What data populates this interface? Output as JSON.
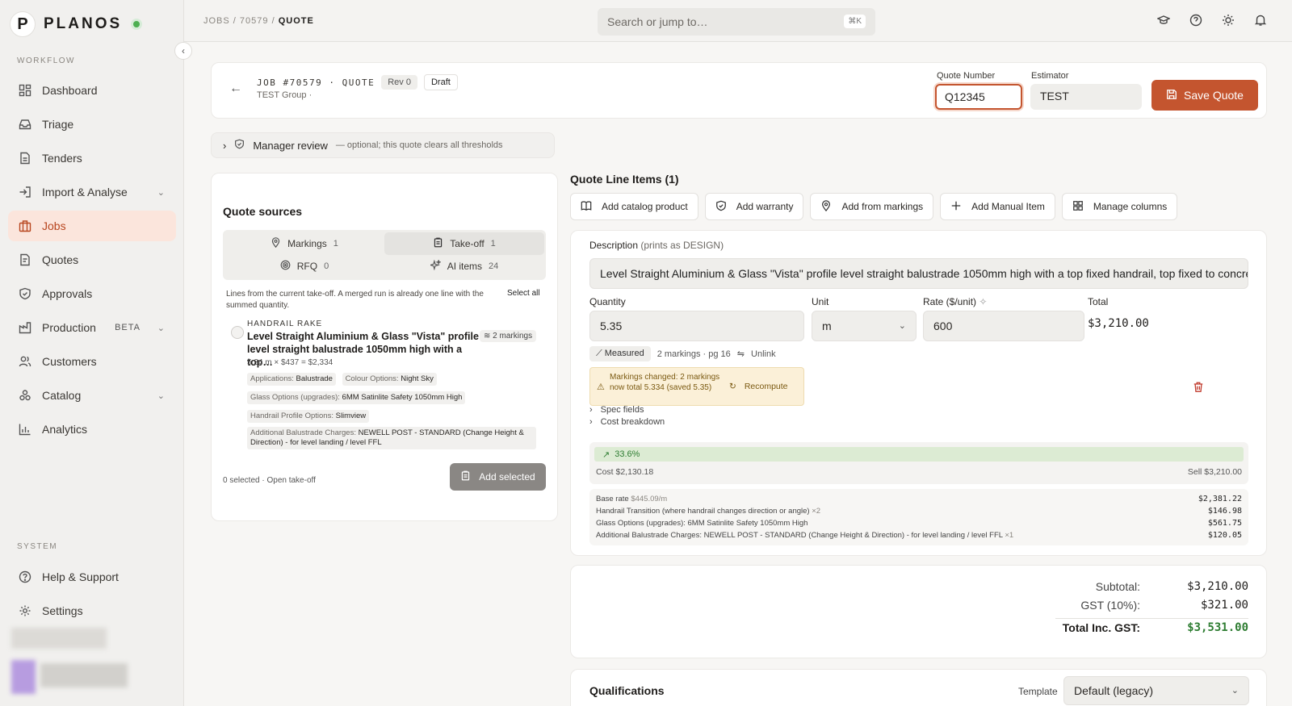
{
  "brand": {
    "name": "PLANOS"
  },
  "sidebar": {
    "workflow_label": "WORKFLOW",
    "system_label": "SYSTEM",
    "items": [
      {
        "label": "Dashboard",
        "icon": "dashboard-icon"
      },
      {
        "label": "Triage",
        "icon": "inbox-icon"
      },
      {
        "label": "Tenders",
        "icon": "document-icon"
      },
      {
        "label": "Import & Analyse",
        "icon": "import-icon"
      },
      {
        "label": "Jobs",
        "icon": "briefcase-icon"
      },
      {
        "label": "Quotes",
        "icon": "quote-icon"
      },
      {
        "label": "Approvals",
        "icon": "shield-check-icon"
      },
      {
        "label": "Production",
        "icon": "factory-icon",
        "badge": "BETA"
      },
      {
        "label": "Customers",
        "icon": "users-icon"
      },
      {
        "label": "Catalog",
        "icon": "catalog-icon"
      },
      {
        "label": "Analytics",
        "icon": "bar-chart-icon"
      }
    ],
    "system_items": [
      {
        "label": "Help & Support",
        "icon": "help-circle-icon"
      },
      {
        "label": "Settings",
        "icon": "gear-icon"
      }
    ]
  },
  "breadcrumb": {
    "part1": "JOBS",
    "sep": "/",
    "part2": "70579",
    "current": "QUOTE"
  },
  "search": {
    "placeholder": "Search or jump to…",
    "shortcut": "⌘K"
  },
  "header": {
    "job_label": "JOB #70579 · QUOTE",
    "rev": "Rev 0",
    "status": "Draft",
    "group": "TEST Group ·",
    "quote_number_label": "Quote Number",
    "quote_number": "Q12345",
    "estimator_label": "Estimator",
    "estimator": "TEST",
    "save_label": "Save Quote"
  },
  "manager_review": {
    "label": "Manager review",
    "note": "— optional; this quote clears all thresholds"
  },
  "sources": {
    "title": "Quote sources",
    "tabs": [
      {
        "label": "Markings",
        "count": "1"
      },
      {
        "label": "Take-off",
        "count": "1"
      },
      {
        "label": "RFQ",
        "count": "0"
      },
      {
        "label": "AI items",
        "count": "24"
      }
    ],
    "note": "Lines from the current take-off. A merged run is already one line with the summed quantity.",
    "select_all": "Select all",
    "item": {
      "kind": "HANDRAIL RAKE",
      "title": "Level Straight Aluminium & Glass \"Vista\" profile level straight balustrade 1050mm high with a top…",
      "markings": "2 markings",
      "calc": "5.34 m × $437 = $2,334",
      "tags": [
        {
          "k": "Applications:",
          "v": "Balustrade"
        },
        {
          "k": "Colour Options:",
          "v": "Night Sky"
        },
        {
          "k": "Glass Options (upgrades):",
          "v": "6MM Satinlite Safety 1050mm High"
        },
        {
          "k": "Handrail Profile Options:",
          "v": "Slimview"
        },
        {
          "k": "Additional Balustrade Charges:",
          "v": "NEWELL POST - STANDARD (Change Height & Direction) - for level landing / level FFL"
        }
      ]
    },
    "selected_text": "0 selected · Open take-off",
    "add_selected": "Add selected"
  },
  "line_items": {
    "title": "Quote Line Items (1)",
    "toolbar": [
      {
        "label": "Add catalog product",
        "icon": "book-icon"
      },
      {
        "label": "Add warranty",
        "icon": "shield-icon"
      },
      {
        "label": "Add from markings",
        "icon": "map-pin-icon"
      },
      {
        "label": "Add Manual Item",
        "icon": "plus-icon"
      },
      {
        "label": "Manage columns",
        "icon": "grid-icon"
      }
    ],
    "description_label": "Description",
    "description_hint": "(prints as DESIGN)",
    "description": "Level Straight Aluminium & Glass \"Vista\" profile level straight balustrade 1050mm high with a top fixed handrail, top fixed to concrete s",
    "quantity_label": "Quantity",
    "quantity": "5.35",
    "unit_label": "Unit",
    "unit": "m",
    "rate_label": "Rate ($/unit)",
    "rate": "600",
    "total_label": "Total",
    "total": "$3,210.00",
    "measured": "Measured",
    "markings_ref": "2 markings · pg 16",
    "unlink": "Unlink",
    "warning": "Markings changed: 2 markings now total 5.334 (saved 5.35)",
    "recompute": "Recompute",
    "spec_fields": "Spec fields",
    "cost_breakdown": "Cost breakdown",
    "margin_pct": "33.6%",
    "margin_fraction": 0.336,
    "cost": "Cost $2,130.18",
    "sell": "Sell $3,210.00",
    "breakdown": [
      {
        "label": "Base rate",
        "extra": "$445.09/m",
        "amount": "$2,381.22"
      },
      {
        "label": "Handrail Transition (where handrail changes direction or angle)",
        "extra": "×2",
        "amount": "$146.98"
      },
      {
        "label": "Glass Options (upgrades): 6MM Satinlite Safety 1050mm High",
        "extra": "",
        "amount": "$561.75"
      },
      {
        "label": "Additional Balustrade Charges: NEWELL POST - STANDARD (Change Height & Direction) - for level landing / level FFL",
        "extra": "×1",
        "amount": "$120.05"
      }
    ]
  },
  "totals": {
    "subtotal_label": "Subtotal:",
    "subtotal": "$3,210.00",
    "gst_label": "GST (10%):",
    "gst": "$321.00",
    "total_label": "Total Inc. GST:",
    "total": "$3,531.00"
  },
  "qualifications": {
    "title": "Qualifications",
    "template_label": "Template",
    "template": "Default (legacy)"
  },
  "colors": {
    "accent": "#c4552f",
    "success": "#2e7d32",
    "warning_bg": "#fbf0d8"
  }
}
